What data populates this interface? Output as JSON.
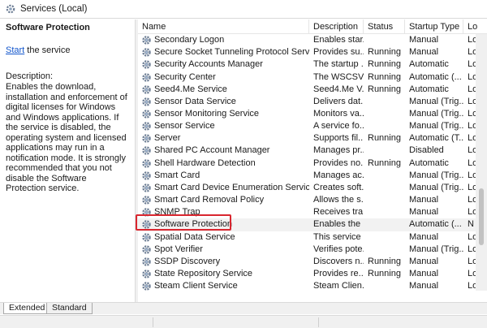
{
  "window": {
    "title": "Services (Local)"
  },
  "left_pane": {
    "heading": "Software Protection",
    "action_link": "Start",
    "action_suffix": " the service",
    "description_label": "Description:",
    "description": "Enables the download, installation and enforcement of digital licenses for Windows and Windows applications. If the service is disabled, the operating system and licensed applications may run in a notification mode. It is strongly recommended that you not disable the Software Protection service."
  },
  "columns": [
    "Name",
    "Description",
    "Status",
    "Startup Type",
    "Lo"
  ],
  "rows": [
    {
      "name": "Secondary Logon",
      "description": "Enables star...",
      "status": "",
      "startup": "Manual",
      "log": "Lo"
    },
    {
      "name": "Secure Socket Tunneling Protocol Service",
      "description": "Provides su...",
      "status": "Running",
      "startup": "Manual",
      "log": "Lo"
    },
    {
      "name": "Security Accounts Manager",
      "description": "The startup ...",
      "status": "Running",
      "startup": "Automatic",
      "log": "Lo"
    },
    {
      "name": "Security Center",
      "description": "The WSCSV...",
      "status": "Running",
      "startup": "Automatic (...",
      "log": "Lo"
    },
    {
      "name": "Seed4.Me Service",
      "description": "Seed4.Me V...",
      "status": "Running",
      "startup": "Automatic",
      "log": "Lo"
    },
    {
      "name": "Sensor Data Service",
      "description": "Delivers dat...",
      "status": "",
      "startup": "Manual (Trig...",
      "log": "Lo"
    },
    {
      "name": "Sensor Monitoring Service",
      "description": "Monitors va...",
      "status": "",
      "startup": "Manual (Trig...",
      "log": "Lo"
    },
    {
      "name": "Sensor Service",
      "description": "A service fo...",
      "status": "",
      "startup": "Manual (Trig...",
      "log": "Lo"
    },
    {
      "name": "Server",
      "description": "Supports fil...",
      "status": "Running",
      "startup": "Automatic (T...",
      "log": "Lo"
    },
    {
      "name": "Shared PC Account Manager",
      "description": "Manages pr...",
      "status": "",
      "startup": "Disabled",
      "log": "Lo"
    },
    {
      "name": "Shell Hardware Detection",
      "description": "Provides no...",
      "status": "Running",
      "startup": "Automatic",
      "log": "Lo"
    },
    {
      "name": "Smart Card",
      "description": "Manages ac...",
      "status": "",
      "startup": "Manual (Trig...",
      "log": "Lo"
    },
    {
      "name": "Smart Card Device Enumeration Service",
      "description": "Creates soft...",
      "status": "",
      "startup": "Manual (Trig...",
      "log": "Lo"
    },
    {
      "name": "Smart Card Removal Policy",
      "description": "Allows the s...",
      "status": "",
      "startup": "Manual",
      "log": "Lo"
    },
    {
      "name": "SNMP Trap",
      "description": "Receives tra...",
      "status": "",
      "startup": "Manual",
      "log": "Lo"
    },
    {
      "name": "Software Protection",
      "description": "Enables the ...",
      "status": "",
      "startup": "Automatic (...",
      "log": "N"
    },
    {
      "name": "Spatial Data Service",
      "description": "This service ...",
      "status": "",
      "startup": "Manual",
      "log": "Lo"
    },
    {
      "name": "Spot Verifier",
      "description": "Verifies pote...",
      "status": "",
      "startup": "Manual (Trig...",
      "log": "Lo"
    },
    {
      "name": "SSDP Discovery",
      "description": "Discovers n...",
      "status": "Running",
      "startup": "Manual",
      "log": "Lo"
    },
    {
      "name": "State Repository Service",
      "description": "Provides re...",
      "status": "Running",
      "startup": "Manual",
      "log": "Lo"
    },
    {
      "name": "Steam Client Service",
      "description": "Steam Clien...",
      "status": "",
      "startup": "Manual",
      "log": "Lo"
    }
  ],
  "selected_row_index": 15,
  "tabs": [
    "Extended",
    "Standard"
  ],
  "colors": {
    "highlight_box": "#d9262f",
    "link": "#1155cc",
    "gear_icon": "#6b7c93"
  }
}
